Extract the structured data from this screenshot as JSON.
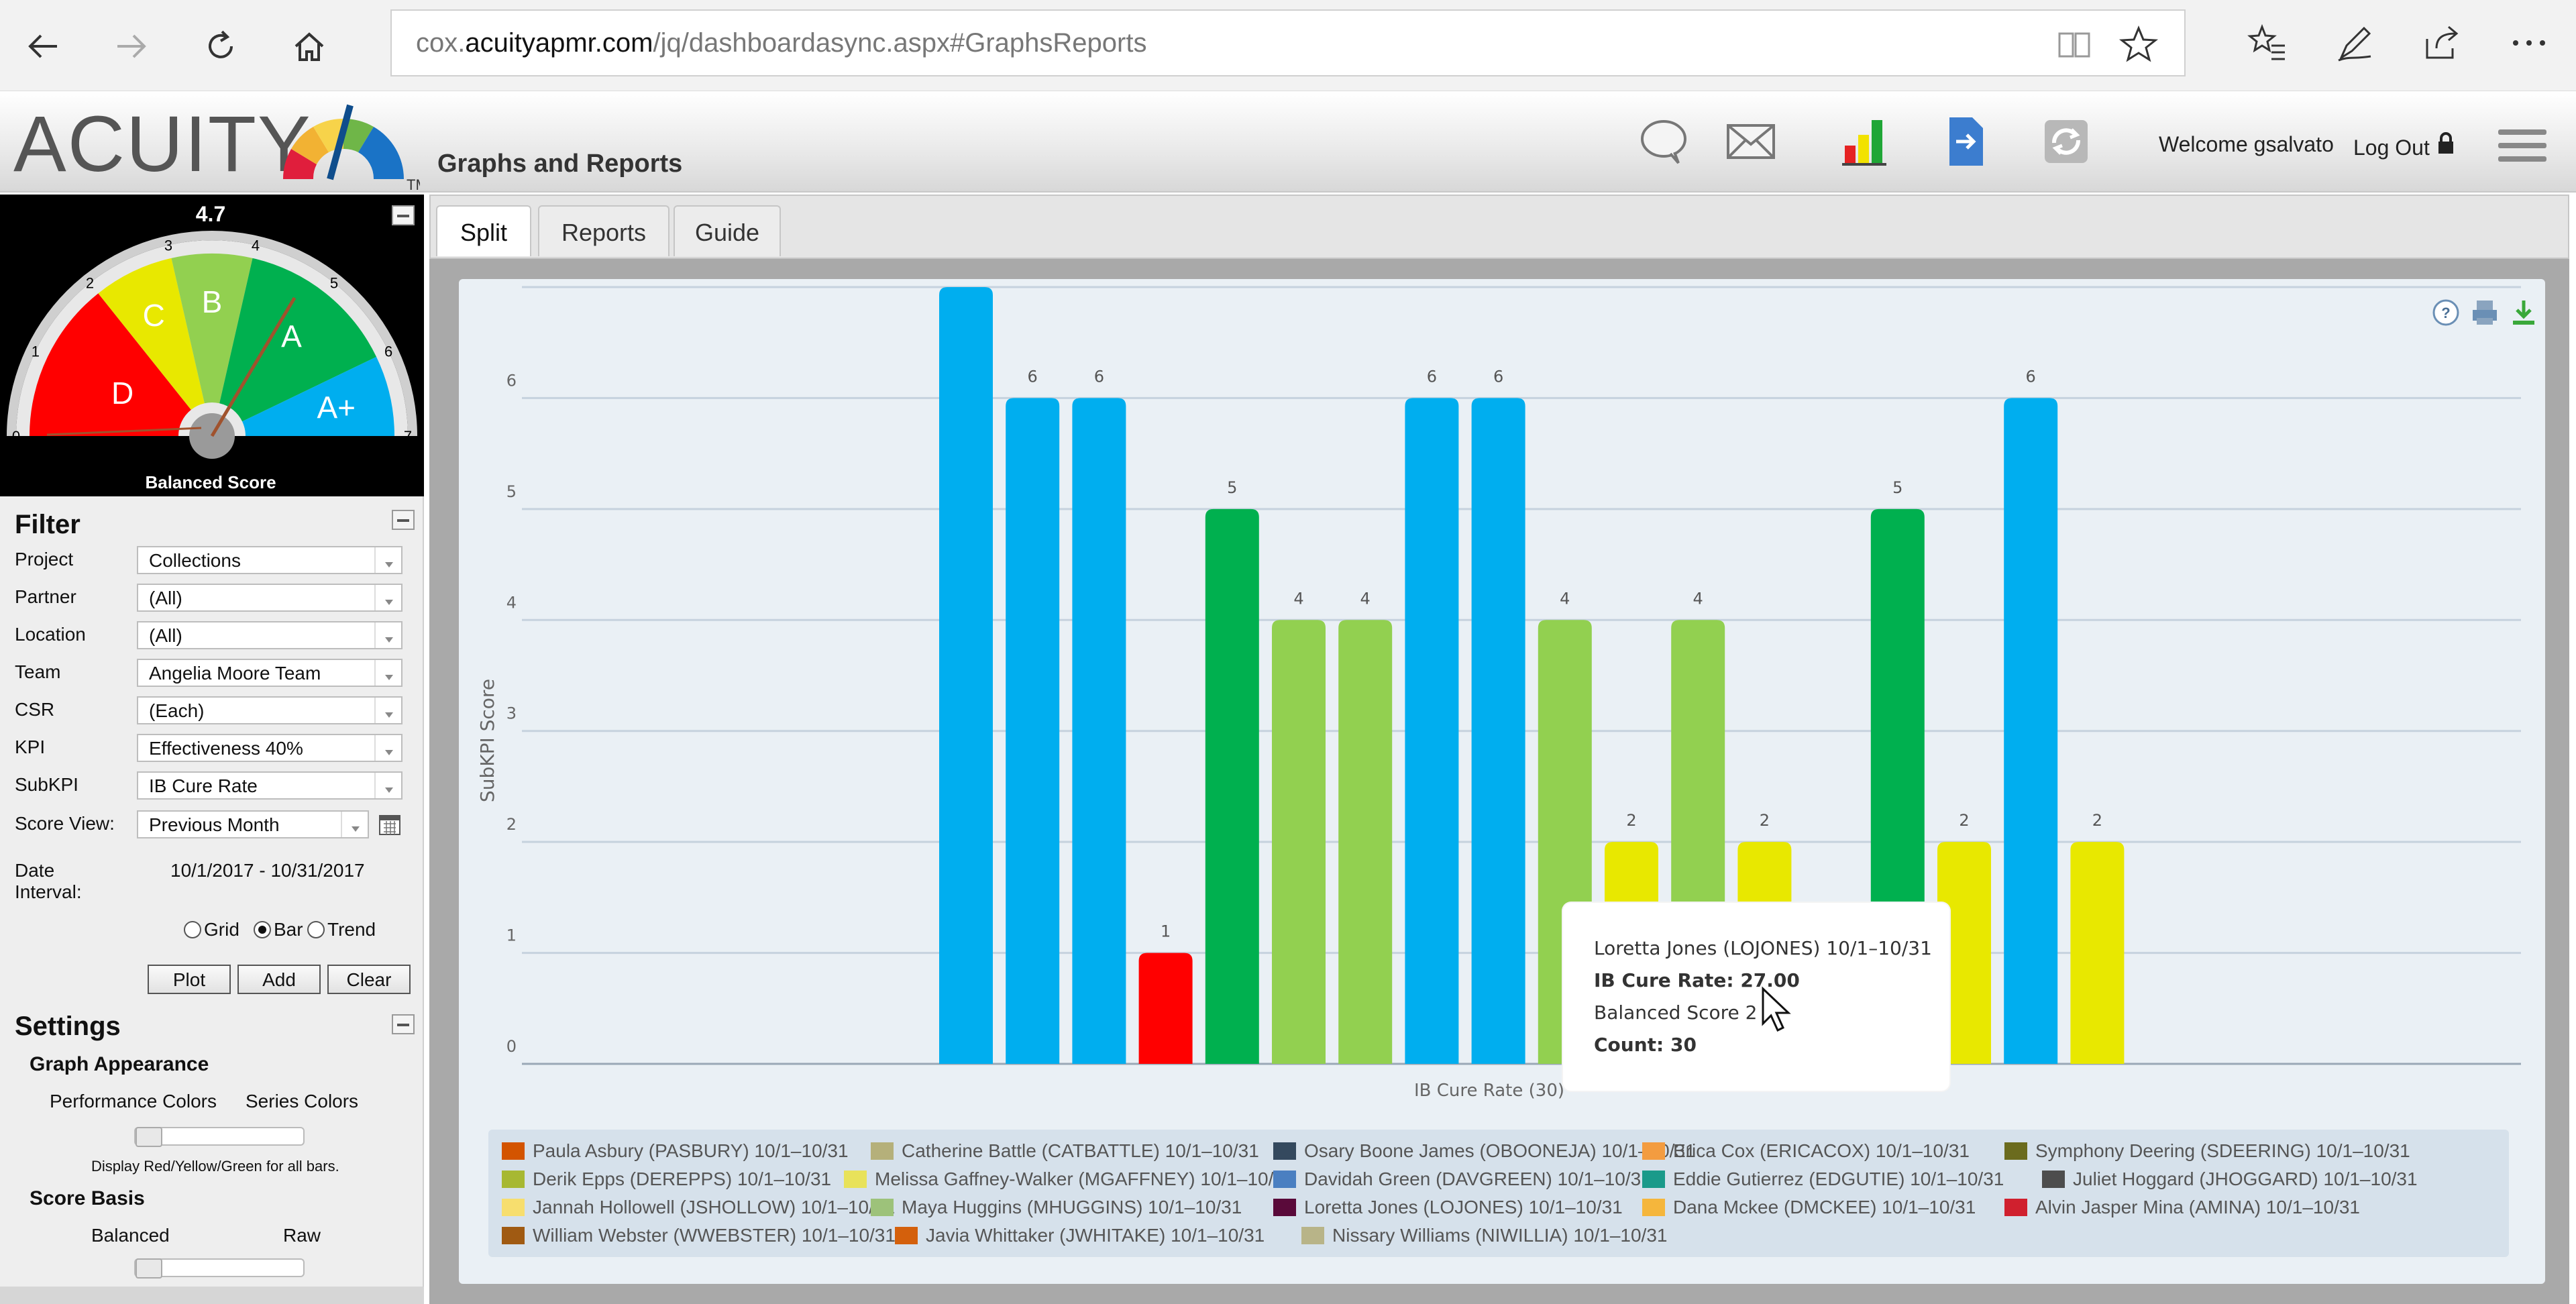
{
  "browser": {
    "url_prefix": "cox.",
    "url_domain": "acuityapmr.com",
    "url_path": "/jq/dashboardasync.aspx#GraphsReports"
  },
  "header": {
    "logo_text": "ACUITY",
    "logo_tm": "TM",
    "title": "Graphs and Reports",
    "welcome": "Welcome gsalvato",
    "logout": "Log Out"
  },
  "gauge": {
    "score": "4.7",
    "label": "Balanced Score",
    "grades": [
      "D",
      "C",
      "B",
      "A",
      "A+"
    ],
    "ticks": [
      "0",
      "1",
      "2",
      "3",
      "4",
      "5",
      "6",
      "7"
    ]
  },
  "filter": {
    "title": "Filter",
    "fields": [
      {
        "label": "Project",
        "value": "Collections"
      },
      {
        "label": "Partner",
        "value": "(All)"
      },
      {
        "label": "Location",
        "value": "(All)"
      },
      {
        "label": "Team",
        "value": "Angelia Moore Team"
      },
      {
        "label": "CSR",
        "value": "(Each)"
      },
      {
        "label": "KPI",
        "value": "Effectiveness 40%"
      },
      {
        "label": "SubKPI",
        "value": "IB Cure Rate"
      },
      {
        "label": "Score View:",
        "value": "Previous Month"
      }
    ],
    "date_label_1": "Date",
    "date_label_2": "Interval:",
    "date_value": "10/1/2017 - 10/31/2017",
    "radio_grid": "Grid",
    "radio_bar": "Bar",
    "radio_trend": "Trend",
    "btn_plot": "Plot",
    "btn_add": "Add",
    "btn_clear": "Clear"
  },
  "settings": {
    "title": "Settings",
    "graph_appearance": "Graph Appearance",
    "perf_colors": "Performance Colors",
    "series_colors": "Series Colors",
    "note": "Display Red/Yellow/Green for all bars.",
    "score_basis": "Score Basis",
    "balanced": "Balanced",
    "raw": "Raw"
  },
  "tabs": [
    "Split",
    "Reports",
    "Guide"
  ],
  "tooltip": {
    "line1": "Loretta Jones (LOJONES) 10/1–10/31",
    "line2": "IB Cure Rate: 27.00",
    "line3": "Balanced Score 2",
    "line4": "Count: 30"
  },
  "chart_data": {
    "type": "bar",
    "ylabel": "SubKPI Score",
    "xlabel": "IB Cure Rate (30)",
    "ylim": [
      0,
      7
    ],
    "yticks": [
      "0",
      "1",
      "2",
      "3",
      "4",
      "5",
      "6",
      "7"
    ],
    "values": [
      7,
      6,
      6,
      1,
      5,
      4,
      4,
      6,
      6,
      4,
      2,
      4,
      2,
      1,
      5,
      2,
      6,
      2
    ],
    "colors": [
      "#00aeef",
      "#00aeef",
      "#00aeef",
      "#ff0000",
      "#00b04f",
      "#92d050",
      "#92d050",
      "#00aeef",
      "#00aeef",
      "#92d050",
      "#e8e800",
      "#92d050",
      "#e8e800",
      "#ff0000",
      "#00b04f",
      "#e8e800",
      "#00aeef",
      "#e8e800"
    ],
    "grid": true,
    "legend": [
      {
        "name": "Paula Asbury (PASBURY) 10/1–10/31",
        "color": "#d35400"
      },
      {
        "name": "Catherine Battle (CATBATTLE) 10/1–10/31",
        "color": "#b5b07a"
      },
      {
        "name": "Osary Boone James (OBOONEJA) 10/1–10/31",
        "color": "#34495e"
      },
      {
        "name": "Erica Cox (ERICACOX) 10/1–10/31",
        "color": "#f39c40"
      },
      {
        "name": "Symphony Deering (SDEERING) 10/1–10/31",
        "color": "#6b6b1e"
      },
      {
        "name": "Derik Epps (DEREPPS) 10/1–10/31",
        "color": "#a7b832"
      },
      {
        "name": "Melissa Gaffney-Walker (MGAFFNEY) 10/1–10/31",
        "color": "#e8e25a"
      },
      {
        "name": "Davidah Green (DAVGREEN) 10/1–10/31",
        "color": "#4a7fc1"
      },
      {
        "name": "Eddie Gutierrez (EDGUTIE) 10/1–10/31",
        "color": "#1a9a8a"
      },
      {
        "name": "Juliet Hoggard (JHOGGARD) 10/1–10/31",
        "color": "#4d4d4d"
      },
      {
        "name": "Jannah Hollowell (JSHOLLOW) 10/1–10/31",
        "color": "#f7de6e"
      },
      {
        "name": "Maya Huggins (MHUGGINS) 10/1–10/31",
        "color": "#9dc27a"
      },
      {
        "name": "Loretta Jones (LOJONES) 10/1–10/31",
        "color": "#5a0a3a"
      },
      {
        "name": "Dana Mckee (DMCKEE) 10/1–10/31",
        "color": "#f5b63c"
      },
      {
        "name": "Alvin Jasper Mina (AMINA) 10/1–10/31",
        "color": "#d0202e"
      },
      {
        "name": "William Webster (WWEBSTER) 10/1–10/31",
        "color": "#a05a12"
      },
      {
        "name": "Javia Whittaker (JWHITAKE) 10/1–10/31",
        "color": "#d4600c"
      },
      {
        "name": "Nissary Williams (NIWILLIA) 10/1–10/31",
        "color": "#b8b488"
      }
    ]
  }
}
